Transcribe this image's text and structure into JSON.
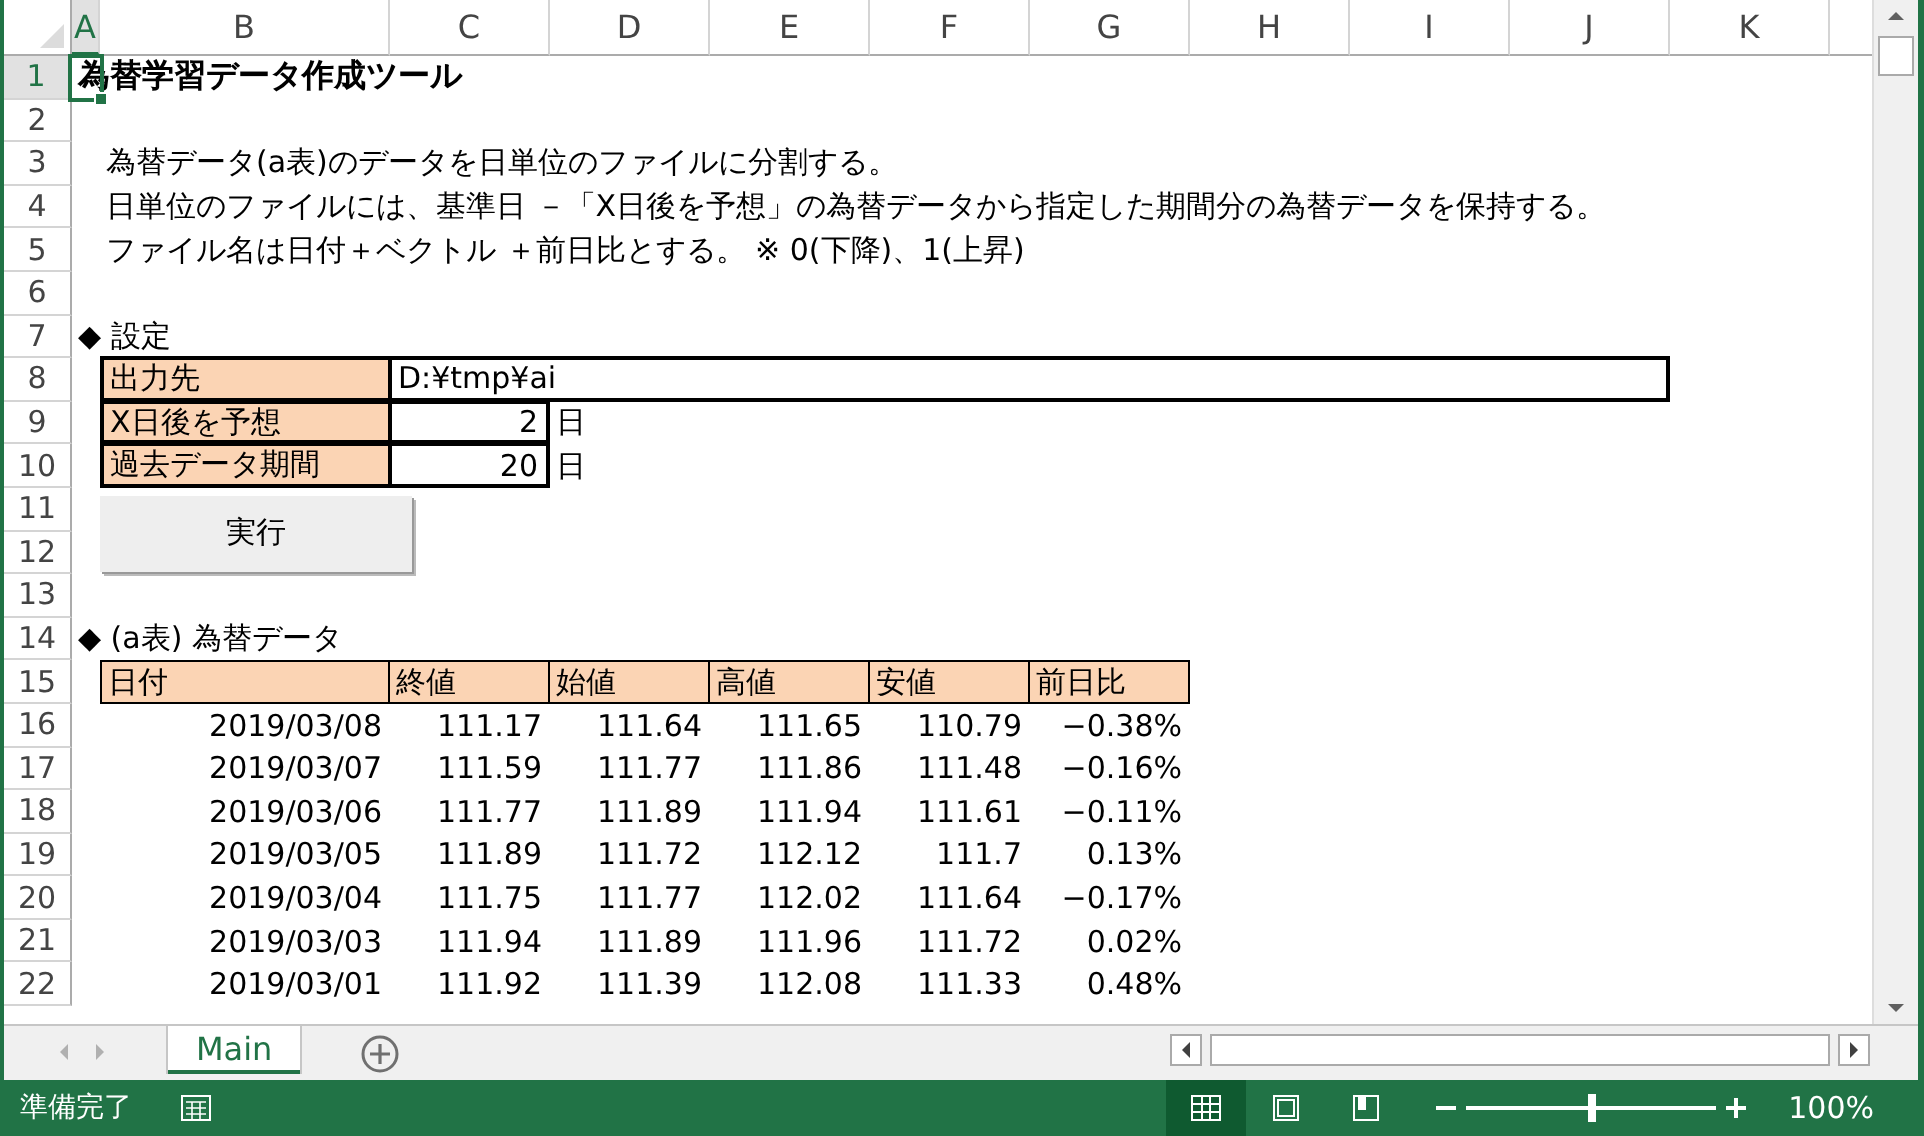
{
  "columns": [
    {
      "label": "A",
      "selected": true
    },
    {
      "label": "B",
      "selected": false
    },
    {
      "label": "C",
      "selected": false
    },
    {
      "label": "D",
      "selected": false
    },
    {
      "label": "E",
      "selected": false
    },
    {
      "label": "F",
      "selected": false
    },
    {
      "label": "G",
      "selected": false
    },
    {
      "label": "H",
      "selected": false
    },
    {
      "label": "I",
      "selected": false
    },
    {
      "label": "J",
      "selected": false
    },
    {
      "label": "K",
      "selected": false
    }
  ],
  "rows": [
    {
      "label": "1",
      "selected": true
    },
    {
      "label": "2",
      "selected": false
    },
    {
      "label": "3",
      "selected": false
    },
    {
      "label": "4",
      "selected": false
    },
    {
      "label": "5",
      "selected": false
    },
    {
      "label": "6",
      "selected": false
    },
    {
      "label": "7",
      "selected": false
    },
    {
      "label": "8",
      "selected": false
    },
    {
      "label": "9",
      "selected": false
    },
    {
      "label": "10",
      "selected": false
    },
    {
      "label": "11",
      "selected": false
    },
    {
      "label": "12",
      "selected": false
    },
    {
      "label": "13",
      "selected": false
    },
    {
      "label": "14",
      "selected": false
    },
    {
      "label": "15",
      "selected": false
    },
    {
      "label": "16",
      "selected": false
    },
    {
      "label": "17",
      "selected": false
    },
    {
      "label": "18",
      "selected": false
    },
    {
      "label": "19",
      "selected": false
    },
    {
      "label": "20",
      "selected": false
    },
    {
      "label": "21",
      "selected": false
    },
    {
      "label": "22",
      "selected": false
    }
  ],
  "title": "為替学習データ作成ツール",
  "description": [
    "為替データ(a表)のデータを日単位のファイルに分割する。",
    "日単位のファイルには、基準日 －「X日後を予想」の為替データから指定した期間分の為替データを保持する。",
    "ファイル名は日付＋ベクトル ＋前日比とする。 ※ 0(下降)、1(上昇)"
  ],
  "settings": {
    "heading": "◆ 設定",
    "fields": [
      {
        "label": "出力先",
        "value": "D:¥tmp¥ai",
        "kind": "text"
      },
      {
        "label": "X日後を予想",
        "value": "2",
        "unit": "日",
        "kind": "number"
      },
      {
        "label": "過去データ期間",
        "value": "20",
        "unit": "日",
        "kind": "number"
      }
    ],
    "button": "実行"
  },
  "table": {
    "heading": "◆ (a表) 為替データ",
    "columns": [
      "日付",
      "終値",
      "始値",
      "高値",
      "安値",
      "前日比"
    ],
    "rows": [
      [
        "2019/03/08",
        "111.17",
        "111.64",
        "111.65",
        "110.79",
        "−0.38%"
      ],
      [
        "2019/03/07",
        "111.59",
        "111.77",
        "111.86",
        "111.48",
        "−0.16%"
      ],
      [
        "2019/03/06",
        "111.77",
        "111.89",
        "111.94",
        "111.61",
        "−0.11%"
      ],
      [
        "2019/03/05",
        "111.89",
        "111.72",
        "112.12",
        "111.7",
        "0.13%"
      ],
      [
        "2019/03/04",
        "111.75",
        "111.77",
        "112.02",
        "111.64",
        "−0.17%"
      ],
      [
        "2019/03/03",
        "111.94",
        "111.89",
        "111.96",
        "111.72",
        "0.02%"
      ],
      [
        "2019/03/01",
        "111.92",
        "111.39",
        "112.08",
        "111.33",
        "0.48%"
      ]
    ]
  },
  "sheet_tabs": [
    {
      "label": "Main",
      "selected": true
    }
  ],
  "status_bar": {
    "status": "準備完了",
    "view_buttons": [
      {
        "kind": "normal",
        "selected": true
      },
      {
        "kind": "page_layout",
        "selected": false
      },
      {
        "kind": "page_break",
        "selected": false
      }
    ],
    "zoom": {
      "level": 0.5,
      "reading": "100%"
    }
  }
}
